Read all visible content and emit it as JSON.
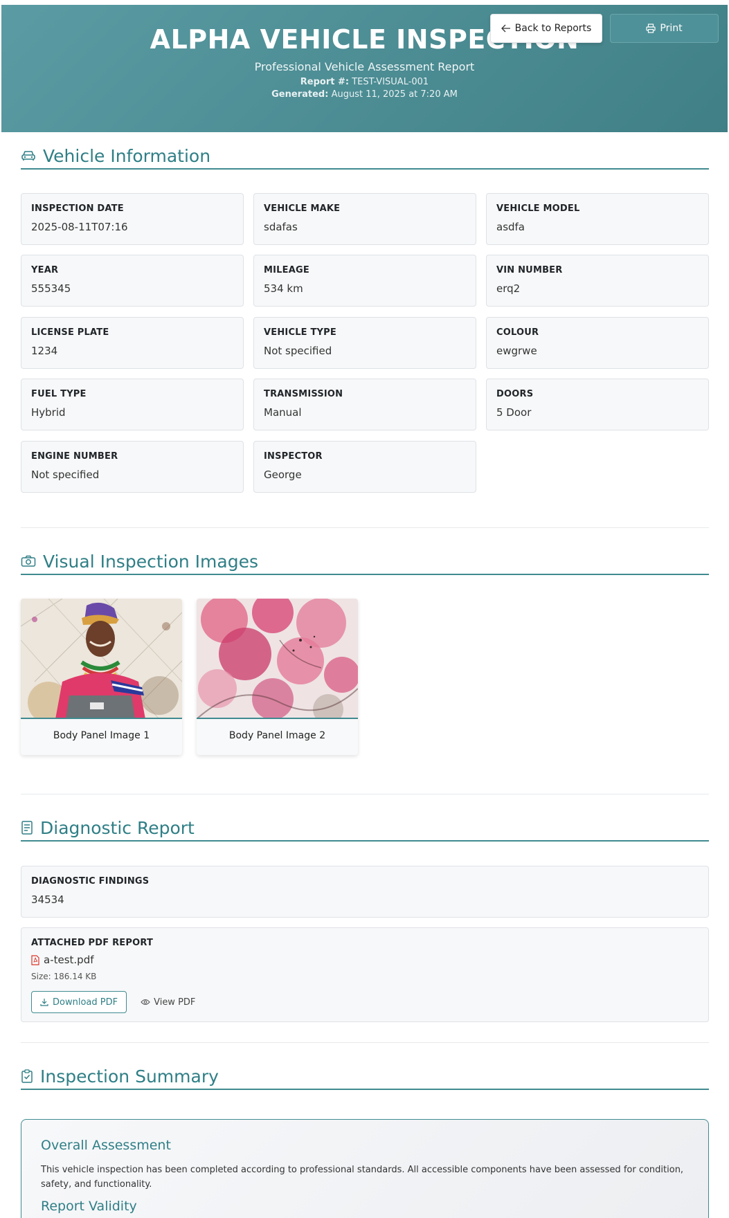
{
  "header": {
    "title": "ALPHA VEHICLE INSPECTION",
    "subtitle": "Professional Vehicle Assessment Report",
    "report_label": "Report #:",
    "report_value": "TEST-VISUAL-001",
    "generated_label": "Generated:",
    "generated_value": "August 11, 2025 at 7:20 AM",
    "back_label": "Back to Reports",
    "print_label": "Print"
  },
  "vehicle_info": {
    "title": "Vehicle Information",
    "fields": [
      {
        "label": "INSPECTION DATE",
        "value": "2025-08-11T07:16"
      },
      {
        "label": "VEHICLE MAKE",
        "value": "sdafas"
      },
      {
        "label": "VEHICLE MODEL",
        "value": "asdfa"
      },
      {
        "label": "YEAR",
        "value": "555345"
      },
      {
        "label": "MILEAGE",
        "value": "534 km"
      },
      {
        "label": "VIN NUMBER",
        "value": "erq2"
      },
      {
        "label": "LICENSE PLATE",
        "value": "1234"
      },
      {
        "label": "VEHICLE TYPE",
        "value": "Not specified"
      },
      {
        "label": "COLOUR",
        "value": "ewgrwe"
      },
      {
        "label": "FUEL TYPE",
        "value": "Hybrid"
      },
      {
        "label": "TRANSMISSION",
        "value": "Manual"
      },
      {
        "label": "DOORS",
        "value": "5 Door"
      },
      {
        "label": "ENGINE NUMBER",
        "value": "Not specified"
      },
      {
        "label": "INSPECTOR",
        "value": "George"
      }
    ]
  },
  "visual": {
    "title": "Visual Inspection Images",
    "images": [
      {
        "caption": "Body Panel Image 1"
      },
      {
        "caption": "Body Panel Image 2"
      }
    ]
  },
  "diagnostic": {
    "title": "Diagnostic Report",
    "findings_label": "DIAGNOSTIC FINDINGS",
    "findings_value": "34534",
    "pdf_label": "ATTACHED PDF REPORT",
    "pdf_name": "a-test.pdf",
    "pdf_size": "Size: 186.14 KB",
    "download_label": "Download PDF",
    "view_label": "View PDF"
  },
  "summary": {
    "title": "Inspection Summary",
    "assessment_title": "Overall Assessment",
    "assessment_text": "This vehicle inspection has been completed according to professional standards. All accessible components have been assessed for condition, safety, and functionality.",
    "validity_title": "Report Validity"
  },
  "colors": {
    "accent": "#3f8a90",
    "header_start": "#5b9ba3",
    "header_end": "#3f7f85",
    "pdf_icon": "#d9342b"
  }
}
